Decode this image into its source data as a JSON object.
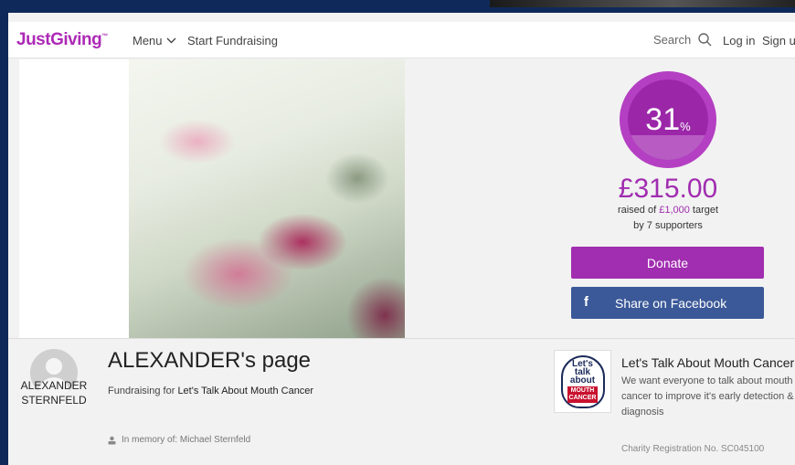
{
  "header": {
    "logo": "JustGiving",
    "logo_tm": "™",
    "menu_label": "Menu",
    "start_label": "Start Fundraising",
    "search_label": "Search",
    "login_label": "Log in",
    "signup_label": "Sign up"
  },
  "progress": {
    "percent": "31",
    "percent_sign": "%",
    "percent_value": 0.31,
    "amount": "£315.00",
    "raised_prefix": "raised of ",
    "target": "£1,000",
    "raised_suffix": " target",
    "supporters_prefix": "by ",
    "supporters_count": "7",
    "supporters_suffix": " supporters"
  },
  "actions": {
    "donate_label": "Donate",
    "share_label": "Share on Facebook",
    "share_icon": "f"
  },
  "profile": {
    "owner_name": "ALEXANDER STERNFELD",
    "page_title": "ALEXANDER's page",
    "fundraising_prefix": "Fundraising for ",
    "charity_link": "Let's Talk About Mouth Cancer",
    "memory": "In memory of: Michael Sternfeld"
  },
  "charity": {
    "logo_line1": "Let's",
    "logo_line2": "talk",
    "logo_line3": "about",
    "logo_red1": "MOUTH",
    "logo_red2": "CANCER",
    "name": "Let's Talk About Mouth Cancer",
    "description": "We want everyone to talk about mouth cancer to improve it's early detection & diagnosis",
    "registration": "Charity Registration No. SC045100"
  },
  "colors": {
    "brand": "#ad29b6",
    "facebook": "#3b5998",
    "frame": "#0f2a5a"
  }
}
